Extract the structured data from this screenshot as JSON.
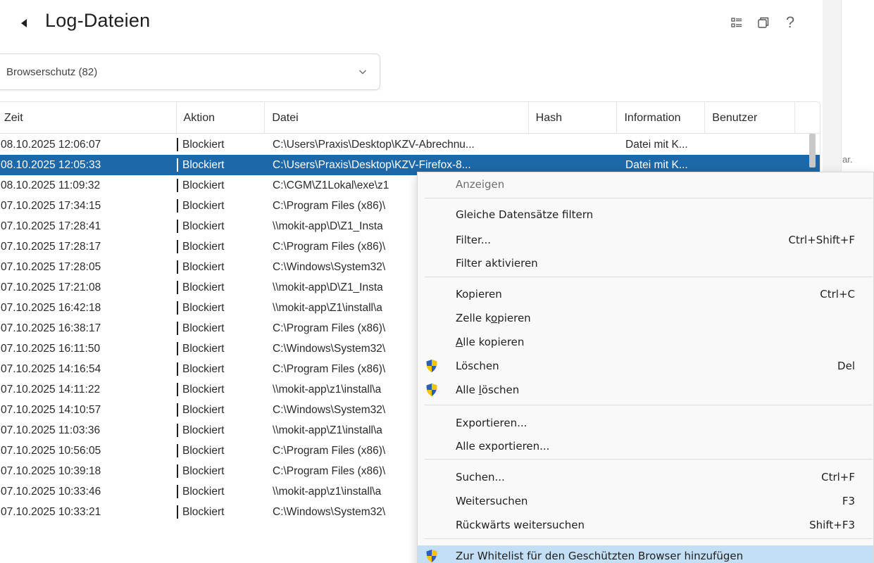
{
  "header": {
    "title": "Log-Dateien"
  },
  "top_icons": [
    "view-toggle-icon",
    "restore-window-icon",
    "help-icon"
  ],
  "help_glyph": "?",
  "dropdown": {
    "selected": "Browserschutz (82)"
  },
  "right_panel_text": "ar.",
  "table": {
    "columns": [
      "Zeit",
      "Aktion",
      "Datei",
      "Hash",
      "Information",
      "Benutzer"
    ],
    "rows": [
      {
        "zeit": "08.10.2025 12:06:07",
        "aktion": "Blockiert",
        "datei": "C:\\Users\\Praxis\\Desktop\\KZV-Abrechnu...",
        "hash": "",
        "info": "Datei mit K...",
        "benutzer": ""
      },
      {
        "zeit": "08.10.2025 12:05:33",
        "aktion": "Blockiert",
        "datei": "C:\\Users\\Praxis\\Desktop\\KZV-Firefox-8...",
        "hash": "",
        "info": "Datei mit K...",
        "benutzer": ""
      },
      {
        "zeit": "08.10.2025 11:09:32",
        "aktion": "Blockiert",
        "datei": "C:\\CGM\\Z1Lokal\\exe\\z1",
        "hash": "",
        "info": "",
        "benutzer": ""
      },
      {
        "zeit": "07.10.2025 17:34:15",
        "aktion": "Blockiert",
        "datei": "C:\\Program Files (x86)\\",
        "hash": "",
        "info": "",
        "benutzer": ""
      },
      {
        "zeit": "07.10.2025 17:28:41",
        "aktion": "Blockiert",
        "datei": "\\\\mokit-app\\D\\Z1_Insta",
        "hash": "",
        "info": "",
        "benutzer": ""
      },
      {
        "zeit": "07.10.2025 17:28:17",
        "aktion": "Blockiert",
        "datei": "C:\\Program Files (x86)\\",
        "hash": "",
        "info": "",
        "benutzer": ""
      },
      {
        "zeit": "07.10.2025 17:28:05",
        "aktion": "Blockiert",
        "datei": "C:\\Windows\\System32\\",
        "hash": "",
        "info": "",
        "benutzer": ""
      },
      {
        "zeit": "07.10.2025 17:21:08",
        "aktion": "Blockiert",
        "datei": "\\\\mokit-app\\D\\Z1_Insta",
        "hash": "",
        "info": "",
        "benutzer": ""
      },
      {
        "zeit": "07.10.2025 16:42:18",
        "aktion": "Blockiert",
        "datei": "\\\\mokit-app\\Z1\\install\\a",
        "hash": "",
        "info": "",
        "benutzer": ""
      },
      {
        "zeit": "07.10.2025 16:38:17",
        "aktion": "Blockiert",
        "datei": "C:\\Program Files (x86)\\",
        "hash": "",
        "info": "",
        "benutzer": ""
      },
      {
        "zeit": "07.10.2025 16:11:50",
        "aktion": "Blockiert",
        "datei": "C:\\Windows\\System32\\",
        "hash": "",
        "info": "",
        "benutzer": ""
      },
      {
        "zeit": "07.10.2025 14:16:54",
        "aktion": "Blockiert",
        "datei": "C:\\Program Files (x86)\\",
        "hash": "",
        "info": "",
        "benutzer": ""
      },
      {
        "zeit": "07.10.2025 14:11:22",
        "aktion": "Blockiert",
        "datei": "\\\\mokit-app\\z1\\install\\a",
        "hash": "",
        "info": "",
        "benutzer": ""
      },
      {
        "zeit": "07.10.2025 14:10:57",
        "aktion": "Blockiert",
        "datei": "C:\\Windows\\System32\\",
        "hash": "",
        "info": "",
        "benutzer": ""
      },
      {
        "zeit": "07.10.2025 11:03:36",
        "aktion": "Blockiert",
        "datei": "\\\\mokit-app\\Z1\\install\\a",
        "hash": "",
        "info": "",
        "benutzer": ""
      },
      {
        "zeit": "07.10.2025 10:56:05",
        "aktion": "Blockiert",
        "datei": "C:\\Program Files (x86)\\",
        "hash": "",
        "info": "",
        "benutzer": ""
      },
      {
        "zeit": "07.10.2025 10:39:18",
        "aktion": "Blockiert",
        "datei": "C:\\Program Files (x86)\\",
        "hash": "",
        "info": "",
        "benutzer": ""
      },
      {
        "zeit": "07.10.2025 10:33:46",
        "aktion": "Blockiert",
        "datei": "\\\\mokit-app\\z1\\install\\a",
        "hash": "",
        "info": "",
        "benutzer": ""
      },
      {
        "zeit": "07.10.2025 10:33:21",
        "aktion": "Blockiert",
        "datei": "C:\\Windows\\System32\\",
        "hash": "",
        "info": "",
        "benutzer": ""
      }
    ],
    "selected_row": 1
  },
  "context_menu": {
    "items": [
      {
        "label": "Anzeigen",
        "shortcut": "",
        "disabled": true
      },
      {
        "label": "Gleiche Datensätze filtern",
        "shortcut": ""
      },
      {
        "label": "Filter...",
        "shortcut": "Ctrl+Shift+F"
      },
      {
        "label": "Filter aktivieren",
        "shortcut": ""
      },
      {
        "label": "Kopieren",
        "shortcut": "Ctrl+C"
      },
      {
        "label": "Zelle kopieren",
        "shortcut": ""
      },
      {
        "label": "Alle kopieren",
        "shortcut": ""
      },
      {
        "label": "Löschen",
        "shortcut": "Del",
        "icon": "uac-shield-icon"
      },
      {
        "label": "Alle löschen",
        "shortcut": "",
        "icon": "uac-shield-icon"
      },
      {
        "label": "Exportieren...",
        "shortcut": ""
      },
      {
        "label": "Alle exportieren...",
        "shortcut": ""
      },
      {
        "label": "Suchen...",
        "shortcut": "Ctrl+F"
      },
      {
        "label": "Weitersuchen",
        "shortcut": "F3"
      },
      {
        "label": "Rückwärts weitersuchen",
        "shortcut": "Shift+F3"
      },
      {
        "label": "Zur Whitelist für den Geschützten Browser hinzufügen",
        "shortcut": "",
        "icon": "uac-shield-icon",
        "highlighted": true
      }
    ]
  },
  "colors": {
    "selection": "#1d68a9",
    "menu_highlight": "#c3dff5",
    "shield_blue": "#2b5fb4",
    "shield_yellow": "#f2c500"
  }
}
